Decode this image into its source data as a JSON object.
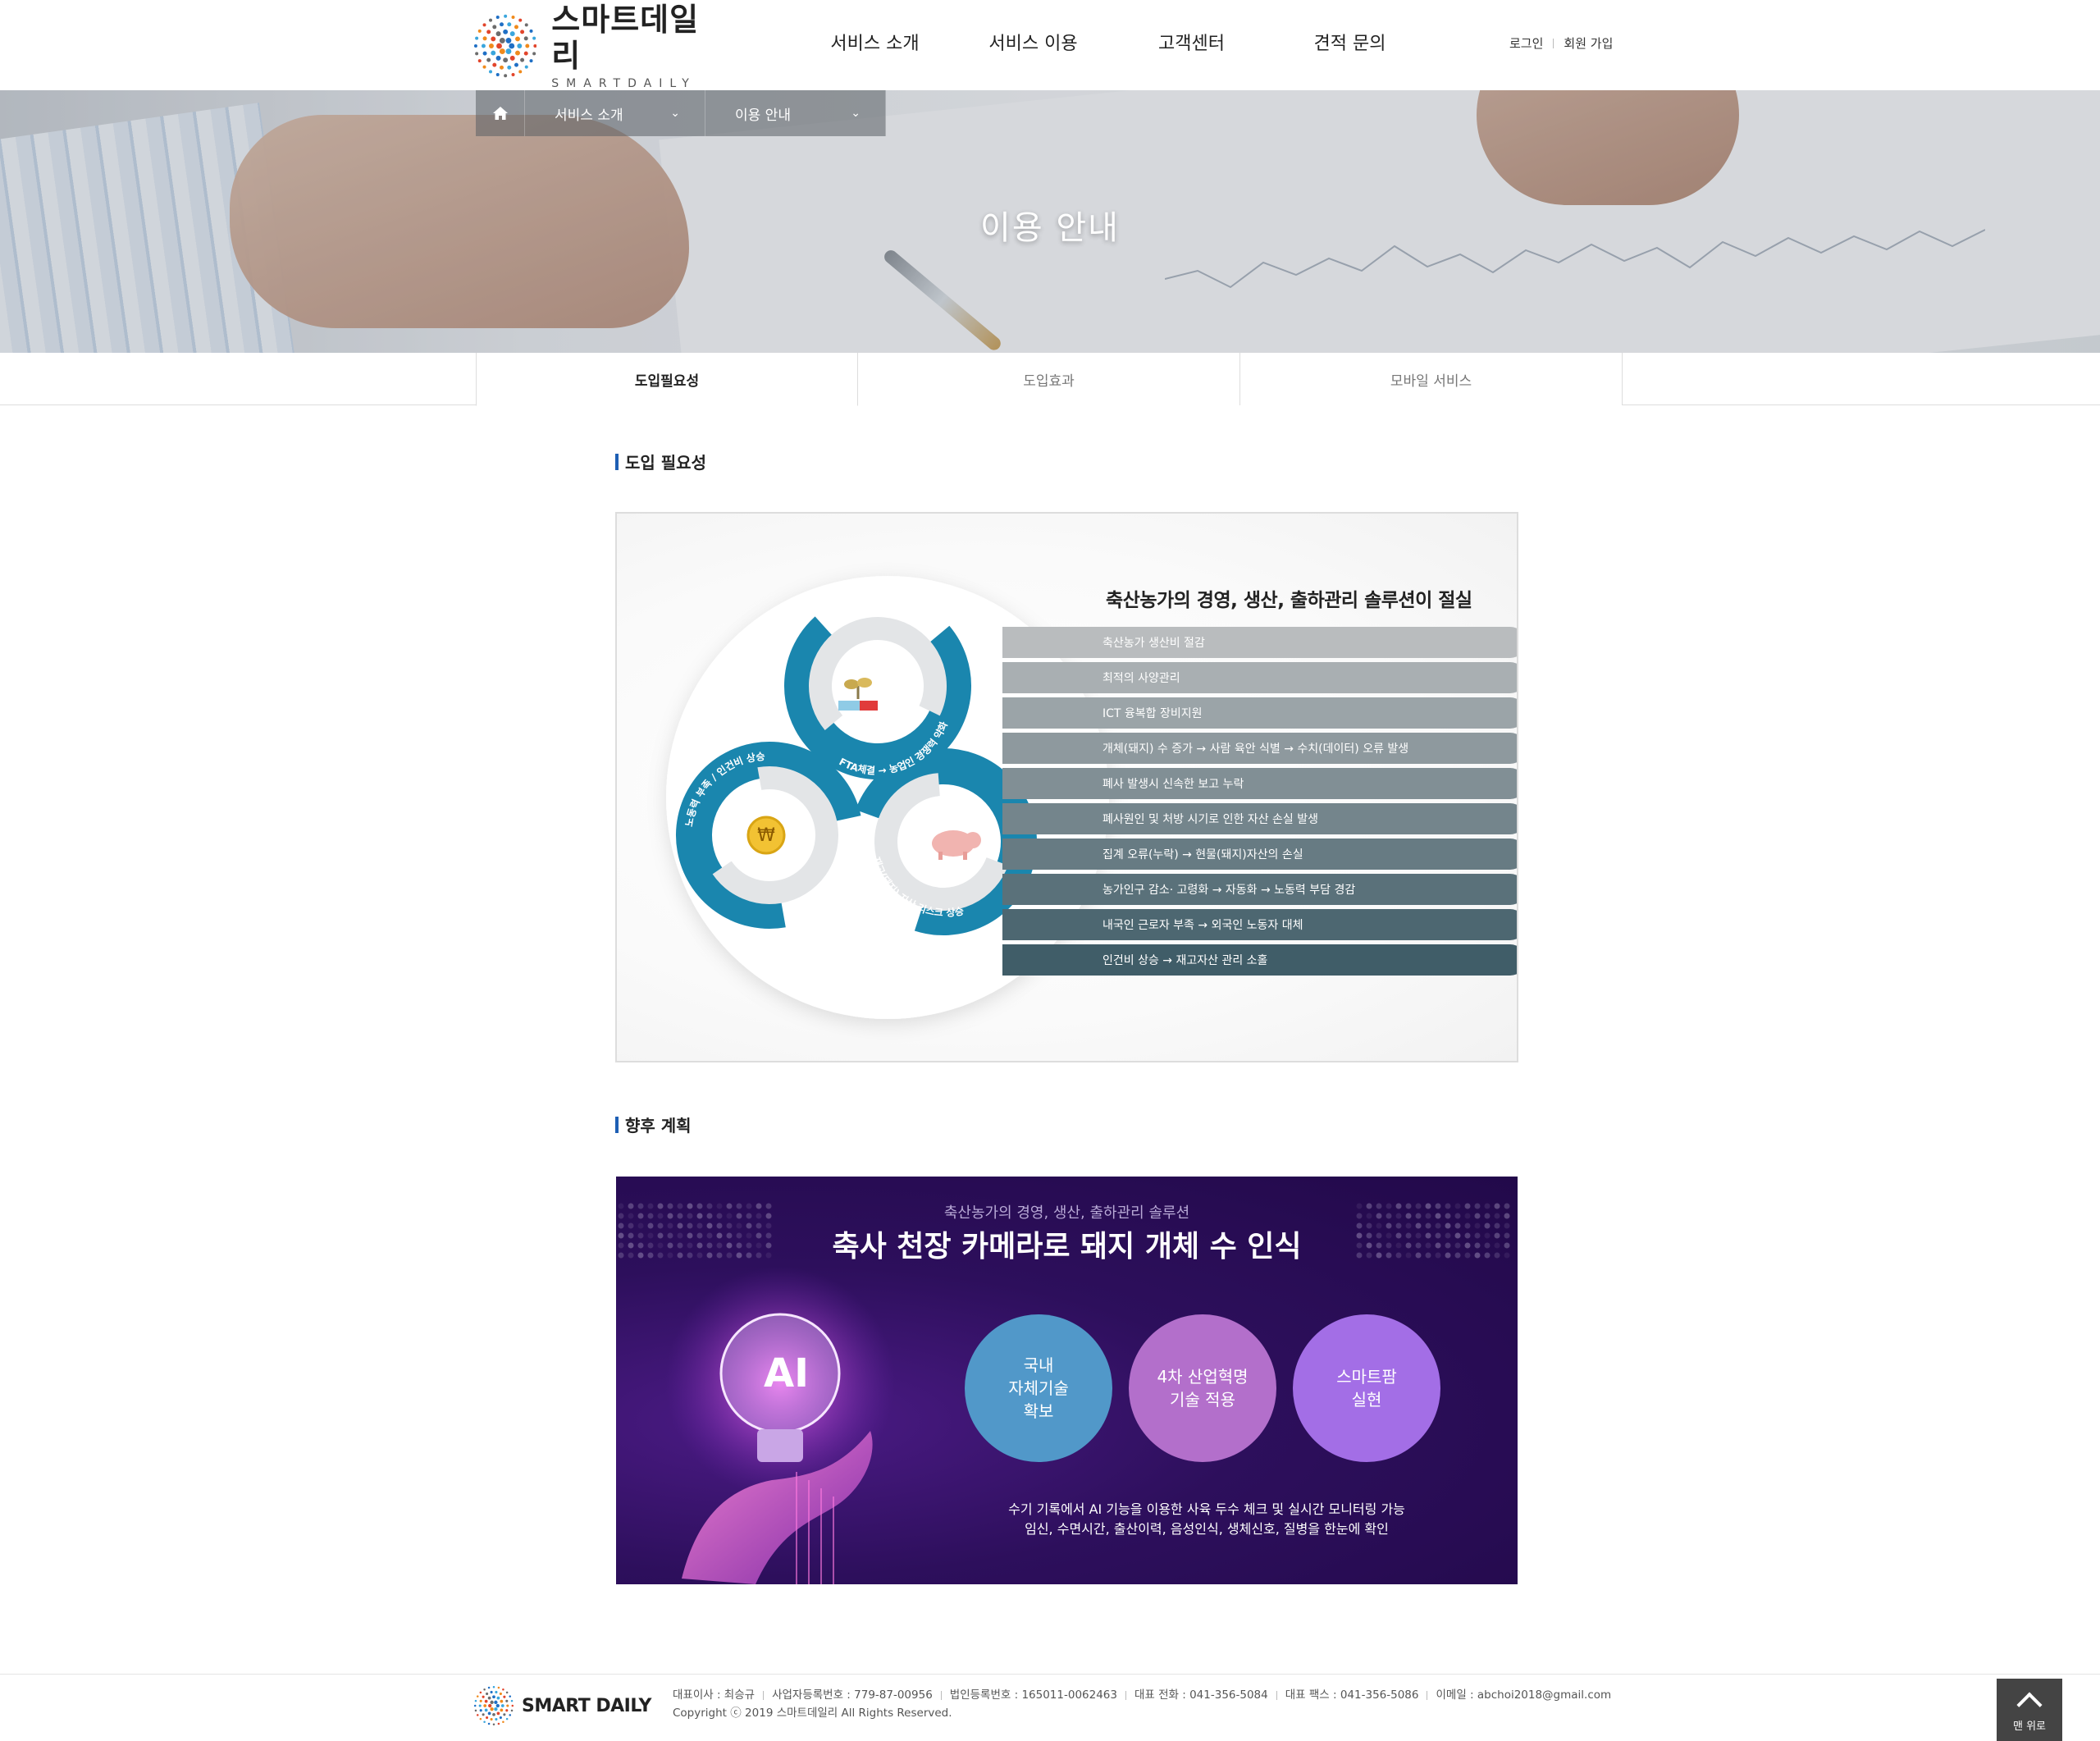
{
  "header": {
    "logo_ko": "스마트데일리",
    "logo_en": "SMARTDAILY",
    "nav": [
      "서비스 소개",
      "서비스 이용",
      "고객센터",
      "견적 문의"
    ],
    "login": "로그인",
    "signup": "회원 가입"
  },
  "visual": {
    "breadcrumb": [
      "서비스 소개",
      "이용 안내"
    ],
    "title": "이용 안내"
  },
  "tabs": [
    "도입필요성",
    "도입효과",
    "모바일 서비스"
  ],
  "sections": {
    "need_title": "도입 필요성",
    "plan_title": "향후 계획"
  },
  "diagram": {
    "heading": "축산농가의 경영, 생산, 출하관리 솔루션이 절실",
    "items": [
      "축산농가 생산비 절감",
      "최적의 사양관리",
      "ICT 융복합 장비지원",
      "개체(돼지) 수 증가 → 사람 육안 식별 → 수치(데이터) 오류 발생",
      "폐사 발생시 신속한 보고 누락",
      "폐사원인 및 처방 시기로 인한 자산 손실 발생",
      "집계 오류(누락) → 현물(돼지)자산의 손실",
      "농가인구 감소· 고령화 → 자동화 → 노동력 부담 경감",
      "내국인 근로자 부족 → 외국인 노동자 대체",
      "인건비 상승 → 재고자산 관리 소홀"
    ],
    "bar_colors": [
      "#b9bcbe",
      "#a9afb2",
      "#9ba4a8",
      "#8e999e",
      "#818f95",
      "#74858c",
      "#677b83",
      "#5a717a",
      "#4d6771",
      "#405d68"
    ],
    "wheel_labels": [
      "FTA체결 → 농업인 경쟁력 약화",
      "노동력 부족 / 인건비 상승",
      "재고(돼지) 자산 리스크 상승"
    ],
    "wheel_color": "#1a86ae"
  },
  "banner": {
    "subtitle": "축산농가의 경영, 생산, 출하관리 솔루션",
    "title": "축사 천장 카메라로 돼지 개체 수 인식",
    "circles": [
      {
        "lines": [
          "국내",
          "자체기술",
          "확보"
        ],
        "color": "#5198c9"
      },
      {
        "lines": [
          "4차 산업혁명",
          "기술 적용"
        ],
        "color": "#b36fcb"
      },
      {
        "lines": [
          "스마트팜",
          "실현"
        ],
        "color": "#a36ee6"
      }
    ],
    "desc_line1": "수기 기록에서 AI 기능을 이용한 사육 두수 체크 및 실시간 모니터링 가능",
    "desc_line2": "임신, 수면시간, 출산이력, 음성인식, 생체신호, 질병을 한눈에 확인",
    "ai_text": "AI"
  },
  "footer": {
    "brand": "SMART DAILY",
    "info": [
      "대표이사 : 최승규",
      "사업자등록번호 : 779-87-00956",
      "법인등록번호 : 165011-0062463",
      "대표 전화 : 041-356-5084",
      "대표 팩스 : 041-356-5086",
      "이메일 : abchoi2018@gmail.com"
    ],
    "copyright": "Copyright ⓒ 2019 스마트데일리 All Rights Reserved.",
    "top_button": "맨 위로"
  }
}
